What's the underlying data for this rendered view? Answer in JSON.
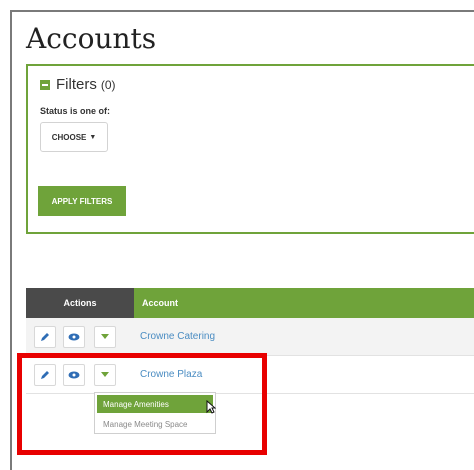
{
  "page": {
    "title": "Accounts"
  },
  "filters": {
    "title": "Filters",
    "count": "(0)",
    "status_label": "Status is one of:",
    "choose_label": "CHOOSE",
    "apply_label": "APPLY FILTERS"
  },
  "table": {
    "headers": {
      "actions": "Actions",
      "account": "Account"
    },
    "rows": [
      {
        "account": "Crowne Catering"
      },
      {
        "account": "Crowne Plaza"
      }
    ]
  },
  "dropdown": {
    "items": [
      "Manage Amenities",
      "Manage Meeting Space"
    ]
  },
  "colors": {
    "accent_green": "#6fa33a",
    "header_dark": "#4a4a4a",
    "link_blue": "#4a8cc2",
    "highlight_red": "#e80000"
  },
  "icons": {
    "collapse": "minus-icon",
    "edit": "pencil-icon",
    "view": "eye-icon",
    "more": "chevron-down-icon",
    "pointer": "cursor-icon"
  }
}
